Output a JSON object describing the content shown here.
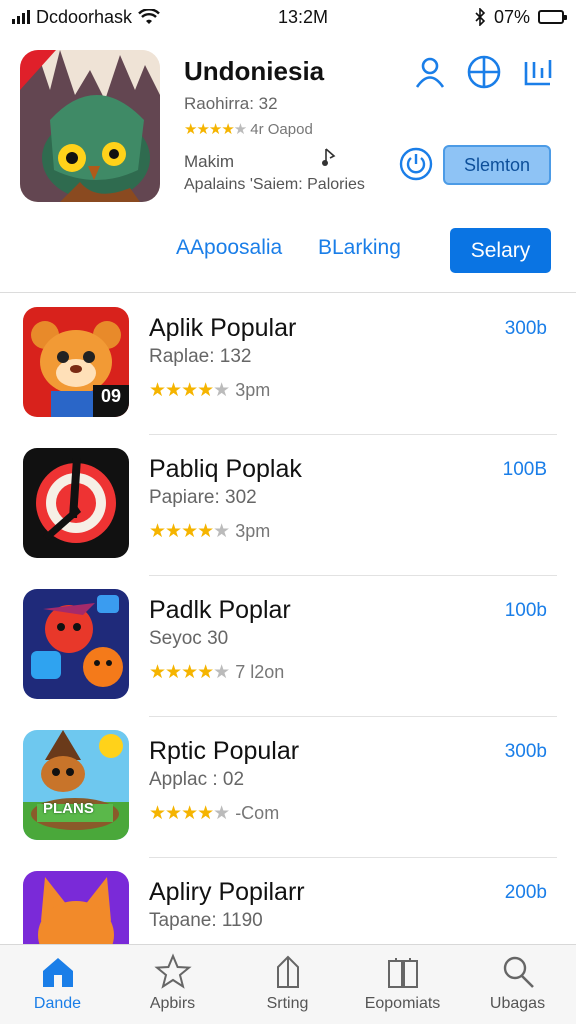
{
  "status_bar": {
    "carrier": "Dcdoorhask",
    "time": "13:2M",
    "battery": "07%",
    "battery_level": 0.7
  },
  "header": {
    "title": "Undoniesia",
    "subtitle": "Raohirra: 32",
    "rating_text": "4r Oapod",
    "meta_label": "Makim",
    "meta_desc": "Apalains 'Saiem: Palories",
    "action_button": "Slemton",
    "icons": [
      "person-icon",
      "compass-icon",
      "stats-icon",
      "power-icon",
      "music-note-icon"
    ]
  },
  "tabs": {
    "tab_a": "AApoosalia",
    "tab_b": "BLarking",
    "tab_primary": "Selary"
  },
  "apps": [
    {
      "name": "Aplik Popular",
      "sub": "Raplae: 132",
      "stars": 4,
      "rating_text": "3pm",
      "price": "300b",
      "badge": "09"
    },
    {
      "name": "Pabliq Poplak",
      "sub": "Papiare: 302",
      "stars": 4,
      "rating_text": "3pm",
      "price": "100B",
      "badge": ""
    },
    {
      "name": "Padlk Poplar",
      "sub": "Seyoc 30",
      "stars": 4,
      "rating_text": "7 l2on",
      "price": "100b",
      "badge": ""
    },
    {
      "name": "Rptic Popular",
      "sub": "Applac : 02",
      "stars": 4,
      "rating_text": "-Com",
      "price": "300b",
      "badge": "PLANS"
    },
    {
      "name": "Apliry Popilarr",
      "sub": "Tapane: 1190",
      "stars": 4,
      "rating_text": "",
      "price": "200b",
      "badge": ""
    }
  ],
  "tabbar": [
    {
      "label": "Dande",
      "icon": "home-icon",
      "active": true
    },
    {
      "label": "Apbirs",
      "icon": "star-icon",
      "active": false
    },
    {
      "label": "Srting",
      "icon": "upload-icon",
      "active": false
    },
    {
      "label": "Eopomiats",
      "icon": "book-icon",
      "active": false
    },
    {
      "label": "Ubagas",
      "icon": "search-icon",
      "active": false
    }
  ],
  "colors": {
    "accent": "#1a7ee8",
    "primary_button": "#0a74e3",
    "star": "#f5b400",
    "battery": "#ff8c00"
  }
}
